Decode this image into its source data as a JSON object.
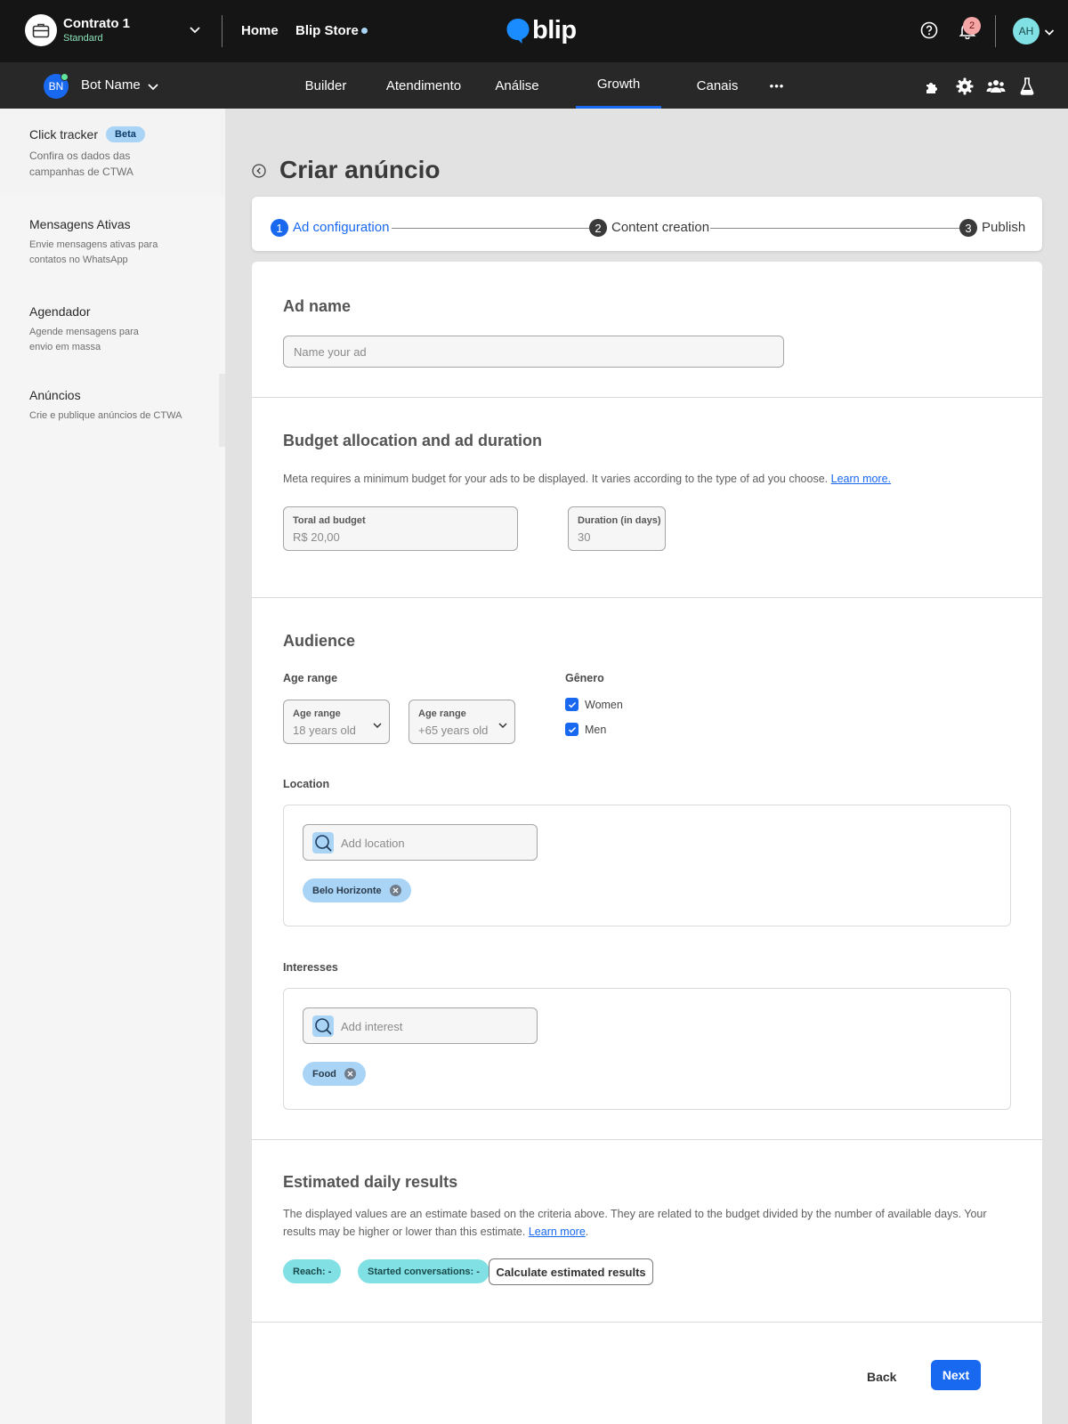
{
  "header": {
    "contract_name": "Contrato 1",
    "contract_plan": "Standard",
    "links": [
      "Home",
      "Blip Store"
    ],
    "brand": "blip",
    "notification_count": "2",
    "user_initials": "AH"
  },
  "navbar": {
    "bot_initials": "BN",
    "bot_name": "Bot Name",
    "tabs": [
      "Builder",
      "Atendimento",
      "Análise",
      "Growth",
      "Canais"
    ],
    "active_tab": "Growth",
    "more": "•••"
  },
  "sidebar": {
    "items": [
      {
        "title": "Click tracker",
        "badge": "Beta",
        "desc_line1": "Confira os dados das",
        "desc_line2": "campanhas de CTWA"
      },
      {
        "title": "Mensagens Ativas",
        "desc_line1": "Envie mensagens ativas para",
        "desc_line2": "contatos no WhatsApp"
      },
      {
        "title": "Agendador",
        "desc_line1": "Agende mensagens para",
        "desc_line2": "envio em massa"
      },
      {
        "title": "Anúncios",
        "desc_line1": "Crie e publique anúncios de CTWA"
      }
    ]
  },
  "page": {
    "title": "Criar anúncio"
  },
  "stepper": {
    "steps": [
      {
        "num": "1",
        "label": "Ad configuration",
        "state": "active"
      },
      {
        "num": "2",
        "label": "Content creation",
        "state": "pending"
      },
      {
        "num": "3",
        "label": "Publish",
        "state": "pending"
      }
    ]
  },
  "ad_name": {
    "title": "Ad name",
    "placeholder": "Name your ad"
  },
  "budget": {
    "title": "Budget allocation and ad duration",
    "description": "Meta requires a minimum budget for your ads to be displayed. It varies according to the type of ad you choose.",
    "learn_more": "Learn more.",
    "total_label": "Toral ad budget",
    "total_value": "R$ 20,00",
    "duration_label": "Duration (in days)",
    "duration_value": "30"
  },
  "audience": {
    "title": "Audience",
    "age_range_label": "Age range",
    "min_age_label": "Age range",
    "min_age_value": "18 years old",
    "max_age_label": "Age range",
    "max_age_value": "+65 years old",
    "gender_label": "Gênero",
    "genders": [
      {
        "label": "Women",
        "checked": true
      },
      {
        "label": "Men",
        "checked": true
      }
    ],
    "location_label": "Location",
    "location_placeholder": "Add location",
    "locations": [
      "Belo Horizonte"
    ],
    "interests_label": "Interesses",
    "interest_placeholder": "Add interest",
    "interests": [
      "Food"
    ]
  },
  "estimates": {
    "title": "Estimated daily results",
    "description_line1": "The displayed values are an estimate based on the criteria above. They are related to the budget divided by the number of available days. Your",
    "description_line2": "results may be higher or lower than this estimate.",
    "learn_more": "Learn more",
    "reach": "Reach: -",
    "conversations": "Started conversations: -",
    "calculate_button": "Calculate estimated results"
  },
  "footer": {
    "back": "Back",
    "next": "Next"
  },
  "colors": {
    "primary": "#1968f0",
    "topbar": "#151515",
    "navbar": "#282828",
    "chip": "#a9d4f5",
    "pill": "#80e0e3",
    "badge": "#f6a6a6"
  }
}
